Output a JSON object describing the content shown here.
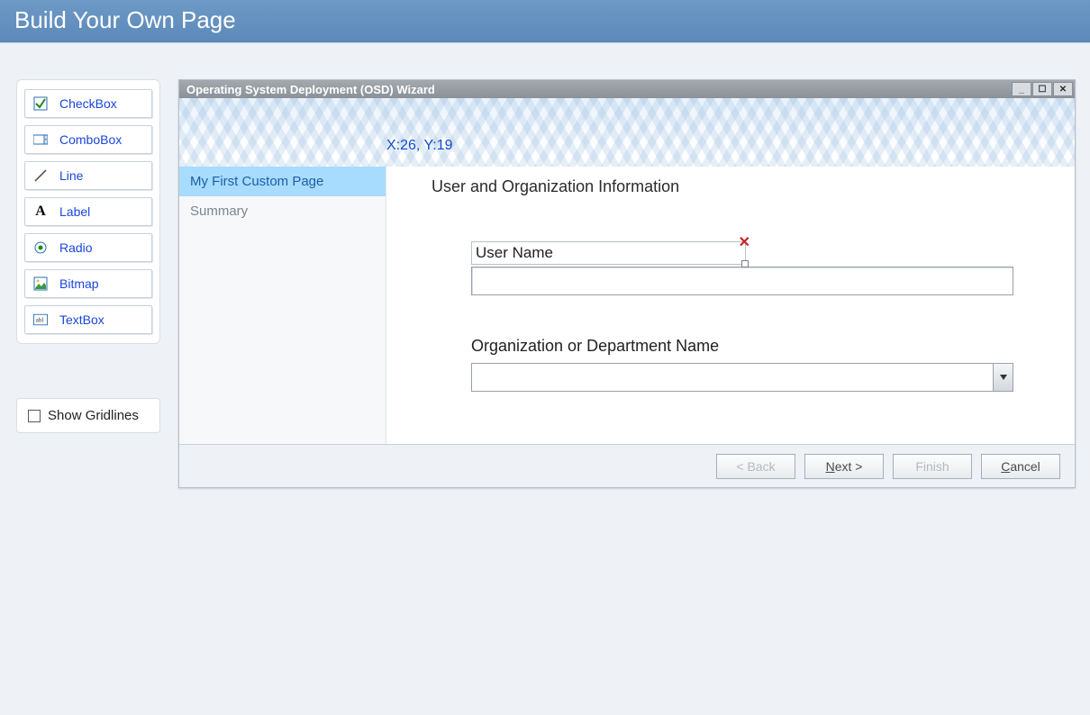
{
  "banner": {
    "title": "Build Your Own Page"
  },
  "palette": {
    "items": [
      {
        "id": "checkbox",
        "label": "CheckBox"
      },
      {
        "id": "combobox",
        "label": "ComboBox"
      },
      {
        "id": "line",
        "label": "Line"
      },
      {
        "id": "label",
        "label": "Label"
      },
      {
        "id": "radio",
        "label": "Radio"
      },
      {
        "id": "bitmap",
        "label": "Bitmap"
      },
      {
        "id": "textbox",
        "label": "TextBox"
      }
    ]
  },
  "gridlines": {
    "label": "Show Gridlines",
    "checked": false
  },
  "wizard": {
    "title": "Operating System Deployment (OSD) Wizard",
    "coords": "X:26, Y:19",
    "nav": [
      {
        "label": "My First Custom Page",
        "active": true
      },
      {
        "label": "Summary",
        "active": false
      }
    ],
    "content": {
      "heading": "User and Organization Information",
      "user_label": "User Name",
      "user_value": "",
      "org_label": "Organization or Department Name",
      "org_value": ""
    },
    "buttons": {
      "back": "< Back",
      "next": "Next >",
      "finish": "Finish",
      "cancel": "Cancel"
    }
  }
}
